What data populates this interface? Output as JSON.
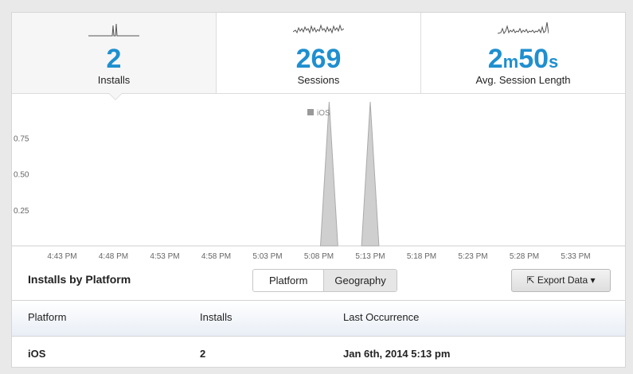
{
  "stats": [
    {
      "value": "2",
      "label": "Installs"
    },
    {
      "value": "269",
      "label": "Sessions"
    },
    {
      "value_parts": [
        "2",
        "m",
        "50",
        "s"
      ],
      "label": "Avg. Session Length"
    }
  ],
  "colors": {
    "accent": "#1f8fcf",
    "series": "#cfcfcf"
  },
  "chart_data": {
    "type": "area",
    "legend": "iOS",
    "legend_position": "top-center",
    "yticks": [
      "0.75",
      "0.50",
      "0.25"
    ],
    "ylim": [
      0,
      1
    ],
    "x_labels": [
      "4:43 PM",
      "4:48 PM",
      "4:53 PM",
      "4:58 PM",
      "5:03 PM",
      "5:08 PM",
      "5:13 PM",
      "5:18 PM",
      "5:23 PM",
      "5:28 PM",
      "5:33 PM"
    ],
    "series": [
      {
        "name": "iOS",
        "x": [
          "5:08 PM",
          "5:09 PM",
          "5:10 PM",
          "5:11 PM",
          "5:12 PM",
          "5:13 PM",
          "5:14 PM"
        ],
        "values": [
          0,
          1,
          0,
          0,
          0,
          1,
          0
        ]
      }
    ],
    "grid": false
  },
  "section": {
    "title": "Installs by Platform"
  },
  "segmented": {
    "platform": "Platform",
    "geography": "Geography"
  },
  "export": {
    "label": "Export Data"
  },
  "table": {
    "headers": [
      "Platform",
      "Installs",
      "Last Occurrence"
    ],
    "rows": [
      [
        "iOS",
        "2",
        "Jan 6th, 2014 5:13 pm"
      ]
    ]
  }
}
